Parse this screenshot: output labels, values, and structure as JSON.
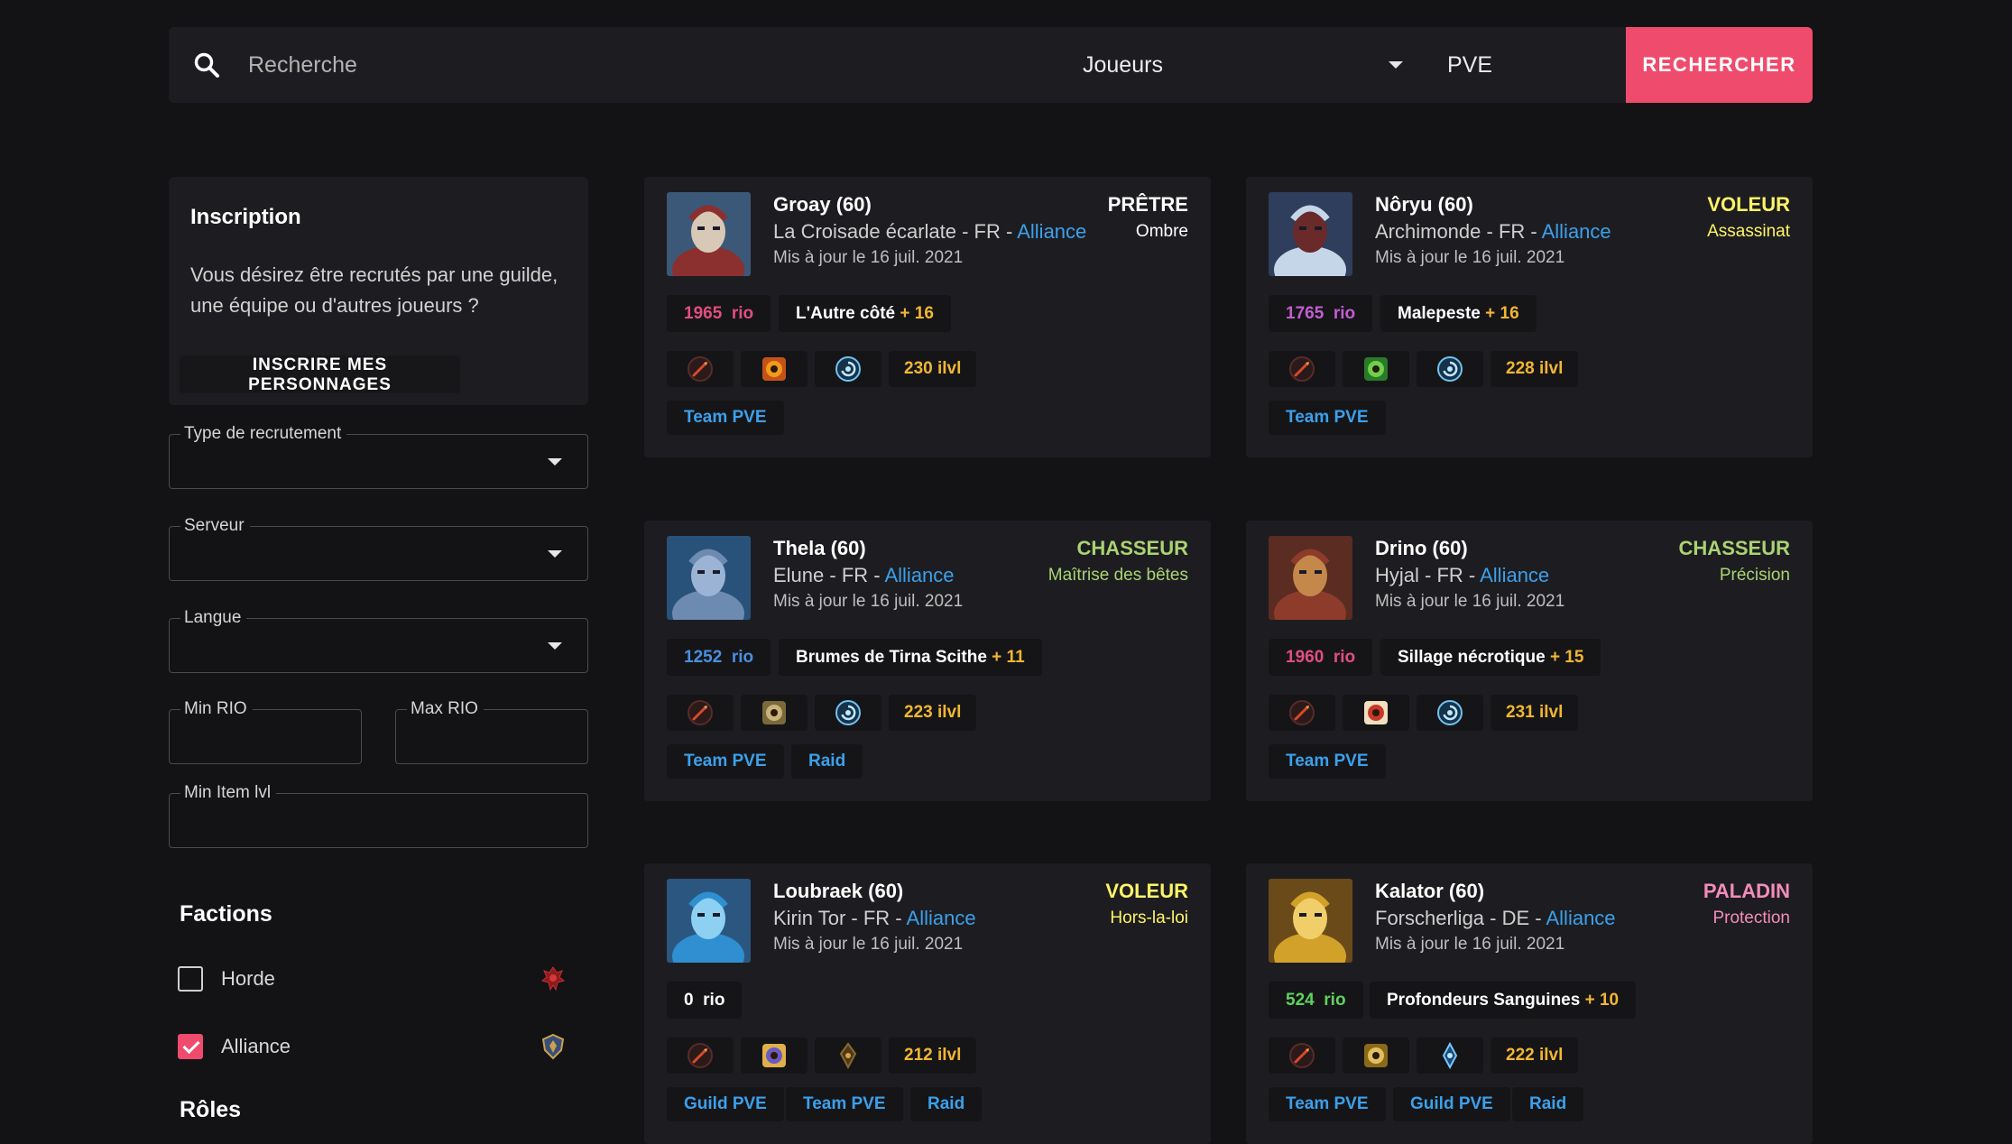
{
  "search": {
    "placeholder": "Recherche",
    "type_value": "Joueurs",
    "mode_value": "PVE",
    "button_label": "RECHERCHER"
  },
  "sidebar": {
    "inscription": {
      "title": "Inscription",
      "text": "Vous désirez être recrutés par une guilde, une équipe ou d'autres joueurs ?",
      "button_label": "INSCRIRE MES PERSONNAGES"
    },
    "filters": {
      "recruitment_label": "Type de recrutement",
      "server_label": "Serveur",
      "language_label": "Langue",
      "min_rio_label": "Min RIO",
      "max_rio_label": "Max RIO",
      "min_ilvl_label": "Min Item lvl"
    },
    "factions_title": "Factions",
    "factions": [
      {
        "label": "Horde",
        "checked": false,
        "icon": "horde-icon"
      },
      {
        "label": "Alliance",
        "checked": true,
        "icon": "alliance-icon"
      }
    ],
    "roles_title": "Rôles"
  },
  "colors": {
    "accent": "#ef4b6d",
    "link": "#3ca0ea",
    "gold": "#f2b632",
    "card_bg": "#1d1d21",
    "page_bg": "#131316"
  },
  "cards": [
    {
      "name": "Groay (60)",
      "realm": "La Croisade écarlate - FR - ",
      "faction": "Alliance",
      "updated": "Mis à jour le 16 juil. 2021",
      "class": "PRÊTRE",
      "class_color": "#ffffff",
      "spec": "Ombre",
      "spec_color": "#ffffff",
      "rio": "1965",
      "rio_word": "rio",
      "rio_color": "#e04f7e",
      "dungeon": "L'Autre côté",
      "dungeon_level": "+ 16",
      "icons": [
        "covenant-icon",
        "legendary-icon",
        "soulbind-icon"
      ],
      "ilvl": "230 ilvl",
      "tags": [
        "Team PVE"
      ]
    },
    {
      "name": "Nôryu (60)",
      "realm": "Archimonde - FR - ",
      "faction": "Alliance",
      "updated": "Mis à jour le 16 juil. 2021",
      "class": "VOLEUR",
      "class_color": "#fff468",
      "spec": "Assassinat",
      "spec_color": "#fff468",
      "rio": "1765",
      "rio_word": "rio",
      "rio_color": "#c15fd0",
      "dungeon": "Malepeste",
      "dungeon_level": "+ 16",
      "icons": [
        "covenant-icon",
        "legendary-icon",
        "soulbind-icon"
      ],
      "ilvl": "228 ilvl",
      "tags": [
        "Team PVE"
      ]
    },
    {
      "name": "Thela (60)",
      "realm": "Elune - FR - ",
      "faction": "Alliance",
      "updated": "Mis à jour le 16 juil. 2021",
      "class": "CHASSEUR",
      "class_color": "#aad372",
      "spec": "Maîtrise des bêtes",
      "spec_color": "#aad372",
      "rio": "1252",
      "rio_word": "rio",
      "rio_color": "#4a8fe0",
      "dungeon": "Brumes de Tirna Scithe",
      "dungeon_level": "+ 11",
      "icons": [
        "covenant-icon",
        "legendary-icon",
        "soulbind-icon"
      ],
      "ilvl": "223 ilvl",
      "tags": [
        "Team PVE",
        "Raid"
      ]
    },
    {
      "name": "Drino (60)",
      "realm": "Hyjal - FR - ",
      "faction": "Alliance",
      "updated": "Mis à jour le 16 juil. 2021",
      "class": "CHASSEUR",
      "class_color": "#aad372",
      "spec": "Précision",
      "spec_color": "#aad372",
      "rio": "1960",
      "rio_word": "rio",
      "rio_color": "#e04f7e",
      "dungeon": "Sillage nécrotique",
      "dungeon_level": "+ 15",
      "icons": [
        "covenant-icon",
        "legendary-icon",
        "soulbind-icon"
      ],
      "ilvl": "231 ilvl",
      "tags": [
        "Team PVE"
      ]
    },
    {
      "name": "Loubraek (60)",
      "realm": "Kirin Tor - FR - ",
      "faction": "Alliance",
      "updated": "Mis à jour le 16 juil. 2021",
      "class": "VOLEUR",
      "class_color": "#fff468",
      "spec": "Hors-la-loi",
      "spec_color": "#fff468",
      "rio": "0",
      "rio_word": "rio",
      "rio_color": "#ffffff",
      "dungeon": "",
      "dungeon_level": "",
      "icons": [
        "covenant-icon",
        "legendary-icon",
        "soulbind-icon"
      ],
      "ilvl": "212 ilvl",
      "tags": [
        "Guild PVE",
        "Team PVE",
        "Raid"
      ]
    },
    {
      "name": "Kalator (60)",
      "realm": "Forscherliga - DE - ",
      "faction": "Alliance",
      "updated": "Mis à jour le 16 juil. 2021",
      "class": "PALADIN",
      "class_color": "#f48cba",
      "spec": "Protection",
      "spec_color": "#f48cba",
      "rio": "524",
      "rio_word": "rio",
      "rio_color": "#5fd25f",
      "dungeon": "Profondeurs Sanguines",
      "dungeon_level": "+ 10",
      "icons": [
        "covenant-icon",
        "legendary-icon",
        "soulbind-icon"
      ],
      "ilvl": "222 ilvl",
      "tags": [
        "Team PVE",
        "Guild PVE",
        "Raid"
      ]
    }
  ]
}
